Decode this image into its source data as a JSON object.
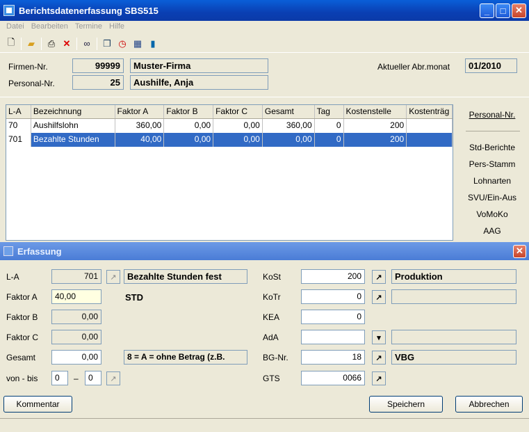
{
  "main_window": {
    "title": "Berichtsdatenerfassung SBS515"
  },
  "menu": [
    "Datei",
    "Bearbeiten",
    "Termine",
    "Hilfe"
  ],
  "toolbar_icons": [
    "new-icon",
    "open-folder-icon",
    "print-icon",
    "delete-icon",
    "binoculars-icon",
    "copy-icon",
    "clock-icon",
    "calendar-icon",
    "chart-icon"
  ],
  "header": {
    "firmen_label": "Firmen-Nr.",
    "firmen_nr": "99999",
    "firmen_name": "Muster-Firma",
    "personal_label": "Personal-Nr.",
    "personal_nr": "25",
    "personal_name": "Aushilfe, Anja",
    "abrmonat_label": "Aktueller Abr.monat",
    "abrmonat": "01/2010"
  },
  "table": {
    "columns": [
      "L-A",
      "Bezeichnung",
      "Faktor A",
      "Faktor B",
      "Faktor C",
      "Gesamt",
      "Tag",
      "Kostenstelle",
      "Kostenträg"
    ],
    "rows": [
      [
        "70",
        "Aushilfslohn",
        "360,00",
        "0,00",
        "0,00",
        "360,00",
        "0",
        "200",
        ""
      ],
      [
        "701",
        "Bezahlte Stunden",
        "40,00",
        "0,00",
        "0,00",
        "0,00",
        "0",
        "200",
        ""
      ]
    ]
  },
  "side": {
    "personal_nr": "Personal-Nr.",
    "std_berichte": "Std-Berichte",
    "pers_stamm": "Pers-Stamm",
    "lohnarten": "Lohnarten",
    "svu": "SVU/Ein-Aus",
    "vomoko": "VoMoKo",
    "aag": "AAG"
  },
  "erfassung": {
    "title": "Erfassung",
    "la_label": "L-A",
    "la_value": "701",
    "la_text": "Bezahlte Stunden     fest",
    "faktor_a_label": "Faktor A",
    "faktor_a_value": "40,00",
    "unit": "STD",
    "faktor_b_label": "Faktor B",
    "faktor_b_value": "0,00",
    "faktor_c_label": "Faktor C",
    "faktor_c_value": "0,00",
    "gesamt_label": "Gesamt",
    "gesamt_value": "0,00",
    "gesamt_text": "8 = A = ohne Betrag (z.B.",
    "vonbis_label": "von - bis",
    "von_value": "0",
    "dash": "–",
    "bis_value": "0",
    "kost_label": "KoSt",
    "kost_value": "200",
    "kost_text": "Produktion",
    "kotr_label": "KoTr",
    "kotr_value": "0",
    "kotr_text": "",
    "kea_label": "KEA",
    "kea_value": "0",
    "ada_label": "AdA",
    "ada_value": "",
    "ada_text": "",
    "bgnr_label": "BG-Nr.",
    "bgnr_value": "18",
    "bgnr_text": "VBG",
    "gts_label": "GTS",
    "gts_value": "0066",
    "kommentar": "Kommentar",
    "speichern": "Speichern",
    "abbrechen": "Abbrechen"
  },
  "colors": {
    "title_blue": "#0a3fb3",
    "selection_blue": "#316ac5",
    "face": "#ece9d8"
  }
}
